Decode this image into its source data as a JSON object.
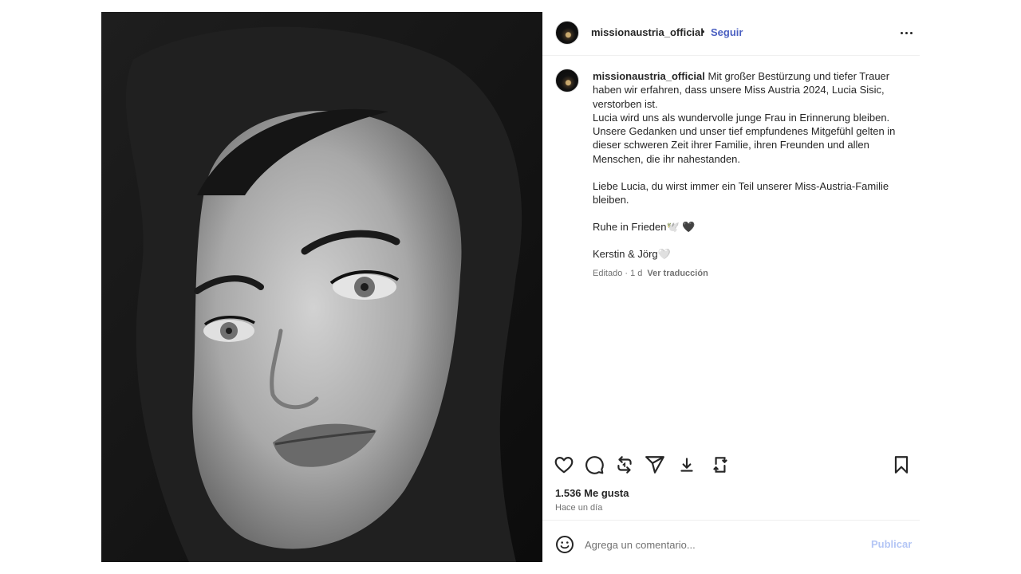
{
  "header": {
    "username": "missionaustria_official",
    "separator": "•",
    "follow_label": "Seguir",
    "more_icon": "more-horizontal-icon"
  },
  "caption": {
    "username": "missionaustria_official",
    "line1": "Mit großer Bestürzung und tiefer Trauer haben wir erfahren, dass unsere Miss Austria 2024, Lucia Sisic, verstorben ist.",
    "line2": "Lucia wird uns als wundervolle junge Frau in Erinnerung bleiben. Unsere Gedanken und unser tief empfundenes Mitgefühl gelten in dieser schweren Zeit ihrer Familie, ihren Freunden und allen Menschen, die ihr nahestanden.",
    "line3": "Liebe Lucia, du wirst immer ein Teil unserer Miss-Austria-Familie bleiben.",
    "line4": "Ruhe in Frieden🕊️ 🖤",
    "line5": "Kerstin & Jörg🤍",
    "edited": "Editado · 1 d",
    "translate": "Ver traducción"
  },
  "actions": {
    "icons": [
      "heart-icon",
      "comment-icon",
      "repost-icon",
      "share-icon",
      "download-icon",
      "save-to-collection-icon",
      "bookmark-icon"
    ]
  },
  "stats": {
    "likes": "1.536 Me gusta",
    "time": "Hace un día"
  },
  "comment": {
    "placeholder": "Agrega un comentario...",
    "publish_label": "Publicar"
  },
  "colors": {
    "accent": "#4a5fc1",
    "publish_disabled": "#b4c6f5",
    "text": "#262626",
    "muted": "#737373"
  }
}
